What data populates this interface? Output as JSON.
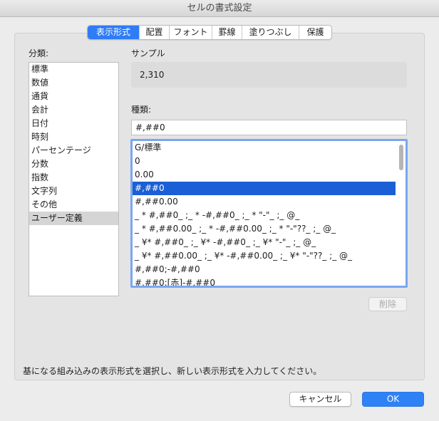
{
  "window": {
    "title": "セルの書式設定"
  },
  "tabs": [
    {
      "label": "表示形式",
      "active": true
    },
    {
      "label": "配置",
      "active": false
    },
    {
      "label": "フォント",
      "active": false
    },
    {
      "label": "罫線",
      "active": false
    },
    {
      "label": "塗りつぶし",
      "active": false
    },
    {
      "label": "保護",
      "active": false
    }
  ],
  "category": {
    "label": "分類:",
    "items": [
      "標準",
      "数値",
      "通貨",
      "会計",
      "日付",
      "時刻",
      "パーセンテージ",
      "分数",
      "指数",
      "文字列",
      "その他",
      "ユーザー定義"
    ],
    "selected": "ユーザー定義"
  },
  "sample": {
    "label": "サンプル",
    "value": "2,310"
  },
  "type": {
    "label": "種類:",
    "input_value": "#,##0",
    "formats": [
      "G/標準",
      "0",
      "0.00",
      "#,##0",
      "#,##0.00",
      "_ * #,##0_ ;_ * -#,##0_ ;_ * \"-\"_ ;_ @_",
      "_ * #,##0.00_ ;_ * -#,##0.00_ ;_ * \"-\"??_ ;_ @_",
      "_ ¥* #,##0_ ;_ ¥* -#,##0_ ;_ ¥* \"-\"_ ;_ @_",
      "_ ¥* #,##0.00_ ;_ ¥* -#,##0.00_ ;_ ¥* \"-\"??_ ;_ @_",
      "#,##0;-#,##0",
      "#,##0;[赤]-#,##0"
    ],
    "selected": "#,##0"
  },
  "buttons": {
    "delete": "削除",
    "cancel": "キャンセル",
    "ok": "OK"
  },
  "description": "基になる組み込みの表示形式を選択し、新しい表示形式を入力してください。",
  "colors": {
    "accent": "#2e7cf6",
    "selection": "#1b5fd6",
    "focus_ring": "#7aa7f0"
  }
}
